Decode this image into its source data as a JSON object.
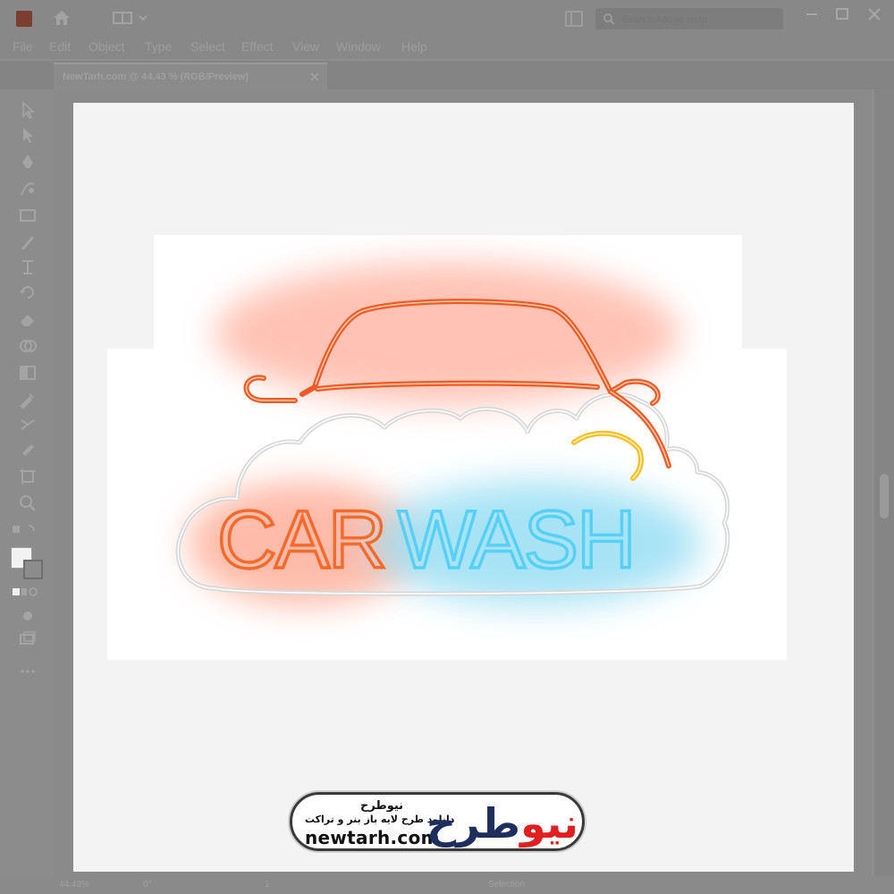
{
  "app": {
    "search_placeholder": "Search Adobe Help"
  },
  "menu": [
    "File",
    "Edit",
    "Object",
    "Type",
    "Select",
    "Effect",
    "View",
    "Window",
    "Help"
  ],
  "document_tab": {
    "label": "NewTarh.com @ 44.43 % (RGB/Preview)"
  },
  "artwork": {
    "word_left": "CAR",
    "word_right": "WASH",
    "colors": {
      "car_outline": "#f05a28",
      "car_word": "#f46a2c",
      "wash_word": "#56d1f5",
      "cloud": "#d8d8d8",
      "bubble": "#f5c02a"
    }
  },
  "status": {
    "zoom": "44.43%",
    "rotation": "0°",
    "artboard": "1",
    "tool": "Selection"
  },
  "watermark": {
    "name_fa": "نیوطرح",
    "tagline_fa": "دانلود طرح لایه باز بنر و تراکت",
    "url": "newtarh.com",
    "logo_part_red": "نیو",
    "logo_part_dark": "طرح"
  }
}
